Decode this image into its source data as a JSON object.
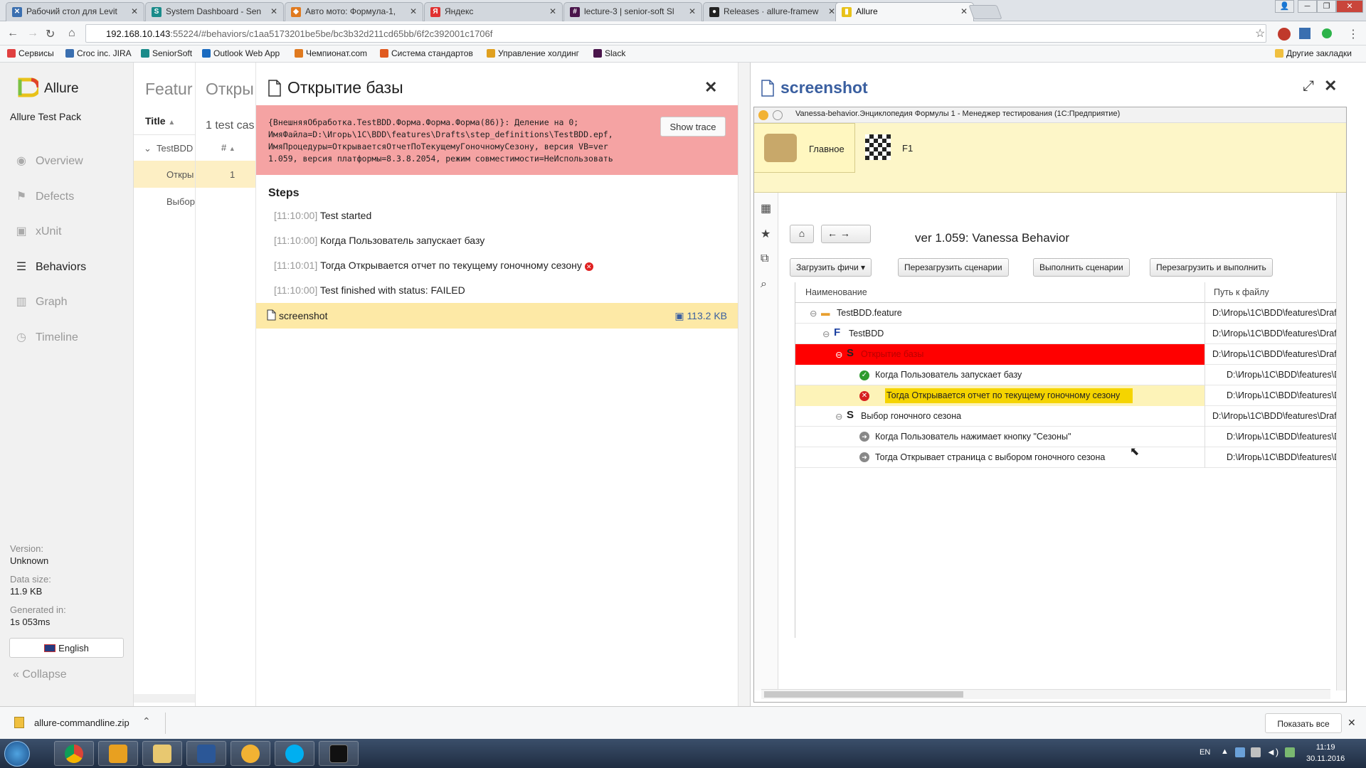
{
  "browser": {
    "tabs": [
      {
        "title": "Рабочий стол для Levit",
        "color": "#3a6fb0"
      },
      {
        "title": "System Dashboard - Sen",
        "color": "#1a8b8a"
      },
      {
        "title": "Авто мото: Формула-1,",
        "color": "#e07a1f"
      },
      {
        "title": "Яндекс",
        "color": "#e03030"
      },
      {
        "title": "lecture-3 | senior-soft Sl",
        "color": "#4a154b"
      },
      {
        "title": "Releases · allure-framew",
        "color": "#222222"
      },
      {
        "title": "Allure",
        "color": "#e8c21a"
      }
    ],
    "url_host": "192.168.10.143",
    "url_rest": ":55224/#behaviors/c1aa5173201be5be/bc3b32d211cd65bb/6f2c392001c1706f",
    "bookmarks": [
      "Сервисы",
      "Croc inc. JIRA",
      "SeniorSoft",
      "Outlook Web App",
      "Чемпионат.com",
      "Система стандартов",
      "Управление холдинг",
      "Slack"
    ],
    "other_bookmarks": "Другие закладки"
  },
  "sidebar": {
    "brand": "Allure",
    "pack": "Allure Test Pack",
    "nav": [
      {
        "label": "Overview",
        "icon": "eye-icon"
      },
      {
        "label": "Defects",
        "icon": "flag-icon"
      },
      {
        "label": "xUnit",
        "icon": "briefcase-icon"
      },
      {
        "label": "Behaviors",
        "icon": "list-icon"
      },
      {
        "label": "Graph",
        "icon": "bar-chart-icon"
      },
      {
        "label": "Timeline",
        "icon": "clock-icon"
      }
    ],
    "version_label": "Version:",
    "version": "Unknown",
    "size_label": "Data size:",
    "size": "11.9 KB",
    "generated_label": "Generated in:",
    "generated": "1s 053ms",
    "language": "English",
    "collapse": "Collapse"
  },
  "features": {
    "title": "Featur",
    "col_title": "Title",
    "group": "TestBDD",
    "items": [
      "Откры",
      "Выбор"
    ]
  },
  "stories": {
    "title": "Откры",
    "count": "1 test cas",
    "col": "#",
    "row": "1"
  },
  "testcase": {
    "title": "Открытие базы",
    "error": "{ВнешняяОбработка.TestBDD.Форма.Форма.Форма(86)}: Деление на 0;\nИмяФайла=D:\\Игорь\\1C\\BDD\\features\\Drafts\\step_definitions\\TestBDD.epf,\nИмяПроцедуры=ОткрываетсяОтчетПоТекущемуГоночномуСезону, версия VB=ver\n1.059, версия платформы=8.3.8.2054, режим совместимости=НеИспользовать",
    "show_trace": "Show trace",
    "steps_header": "Steps",
    "steps": [
      {
        "time": "[11:10:00]",
        "text": "Test started",
        "failed": false
      },
      {
        "time": "[11:10:00]",
        "text": "Когда Пользователь запускает базу",
        "failed": false
      },
      {
        "time": "[11:10:01]",
        "text": "Тогда Открывается отчет по текущему гоночному сезону",
        "failed": true
      },
      {
        "time": "[11:10:00]",
        "text": "Test finished with status: FAILED",
        "failed": false
      }
    ],
    "attachment": {
      "name": "screenshot",
      "size": "113.2 KB"
    }
  },
  "screenshot": {
    "title": "screenshot",
    "window_title": "Vanessa-behavior.Энциклопедия Формулы 1 - Менеджер тестирования (1С:Предприятие)",
    "tab_main": "Главное",
    "tab_f1": "F1",
    "heading": "ver 1.059: Vanessa Behavior",
    "buttons": [
      "Загрузить фичи",
      "Перезагрузить сценарии",
      "Выполнить сценарии",
      "Перезагрузить и выполнить"
    ],
    "col_name": "Наименование",
    "col_path": "Путь к файлу",
    "rows": [
      {
        "name": "TestBDD.feature",
        "path": "D:\\Игорь\\1C\\BDD\\features\\Draf",
        "kind": "folder"
      },
      {
        "name": "TestBDD",
        "path": "D:\\Игорь\\1C\\BDD\\features\\Draf",
        "kind": "feature"
      },
      {
        "name": "Открытие базы",
        "path": "D:\\Игорь\\1C\\BDD\\features\\Draf",
        "kind": "scenario-failed"
      },
      {
        "name": "Когда Пользователь запускает базу",
        "path": "D:\\Игорь\\1C\\BDD\\features\\D",
        "kind": "step-ok"
      },
      {
        "name": "Тогда Открывается отчет по текущему гоночному сезону",
        "path": "D:\\Игорь\\1C\\BDD\\features\\D",
        "kind": "step-failed"
      },
      {
        "name": "Выбор гоночного сезона",
        "path": "D:\\Игорь\\1C\\BDD\\features\\Draf",
        "kind": "scenario"
      },
      {
        "name": "Когда Пользователь нажимает кнопку \"Сезоны\"",
        "path": "D:\\Игорь\\1C\\BDD\\features\\D",
        "kind": "step-skip"
      },
      {
        "name": "Тогда Открывает страница с выбором гоночного сезона",
        "path": "D:\\Игорь\\1C\\BDD\\features\\D",
        "kind": "step-skip"
      }
    ]
  },
  "downloads": {
    "file": "allure-commandline.zip",
    "show_all": "Показать все"
  },
  "taskbar": {
    "lang": "EN",
    "time": "11:19",
    "date": "30.11.2016"
  }
}
